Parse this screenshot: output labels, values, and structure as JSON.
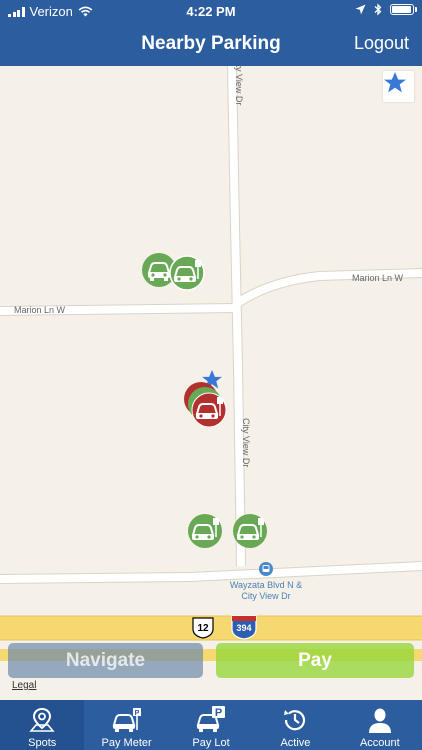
{
  "status_bar": {
    "carrier": "Verizon",
    "time": "4:22 PM",
    "battery_level": 0.95,
    "signal_icon": "signal-bars-icon",
    "wifi_icon": "wifi-icon",
    "location_icon": "location-arrow-icon",
    "bluetooth_icon": "bluetooth-icon"
  },
  "nav": {
    "title": "Nearby Parking",
    "logout_label": "Logout"
  },
  "map": {
    "street_labels": {
      "city_view_top": "City View Dr",
      "city_view_mid": "City View Dr",
      "marion_left": "Marion Ln W",
      "marion_right": "Marion Ln W"
    },
    "poi_label_line1": "Wayzata Blvd N &",
    "poi_label_line2": "City View Dr",
    "shields": {
      "us_route": "12",
      "interstate": "394"
    },
    "favorite_icon": "star-icon",
    "colors": {
      "available": "#69a956",
      "occupied": "#b2302d",
      "favorite": "#3a78d8",
      "highway": "#f6d870",
      "land": "#f5f1e8",
      "road": "#ffffff",
      "transit": "#4a89c9"
    }
  },
  "actions": {
    "navigate_label": "Navigate",
    "pay_label": "Pay",
    "legal_label": "Legal"
  },
  "tabs": [
    {
      "label": "Spots",
      "icon": "map-pin-icon",
      "active": true
    },
    {
      "label": "Pay Meter",
      "icon": "car-meter-icon",
      "active": false
    },
    {
      "label": "Pay Lot",
      "icon": "car-lot-icon",
      "active": false
    },
    {
      "label": "Active",
      "icon": "history-clock-icon",
      "active": false
    },
    {
      "label": "Account",
      "icon": "user-icon",
      "active": false
    }
  ]
}
